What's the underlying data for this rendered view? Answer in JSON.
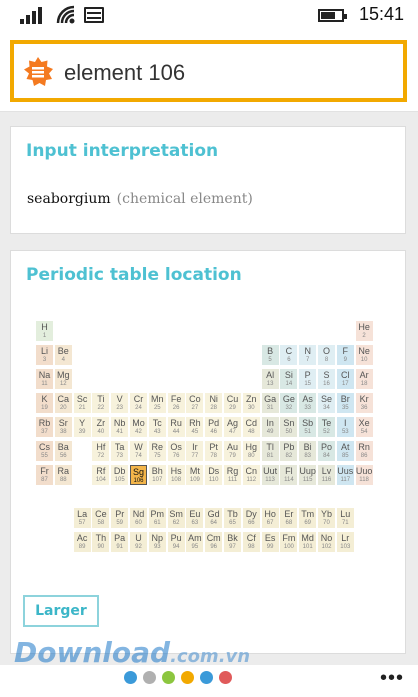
{
  "status_bar": {
    "time": "15:41"
  },
  "search": {
    "query": "element 106"
  },
  "pods": {
    "input_interpretation": {
      "title": "Input interpretation",
      "value": "seaborgium",
      "qualifier": "(chemical element)"
    },
    "periodic_table": {
      "title": "Periodic table location",
      "larger_label": "Larger",
      "selected_symbol": "Sg"
    }
  },
  "category_colors": {
    "h": "#e3eedd",
    "alkali": "#f2ddcb",
    "alkaline": "#f4e7d2",
    "transition": "#f7f2dc",
    "post": "#e6e8d9",
    "metalloid": "#d8e8e4",
    "nonmetal": "#dfeef3",
    "halogen": "#cfe6f1",
    "noble": "#f6e2d8",
    "lanth": "#f4eed5",
    "act": "#f4eed5"
  },
  "elements": [
    {
      "s": "H",
      "n": "1",
      "c": "h"
    },
    {
      "s": "He",
      "n": "2",
      "c": "noble"
    },
    {
      "s": "Li",
      "n": "3",
      "c": "alkali"
    },
    {
      "s": "Be",
      "n": "4",
      "c": "alkaline"
    },
    {
      "s": "B",
      "n": "5",
      "c": "metalloid"
    },
    {
      "s": "C",
      "n": "6",
      "c": "nonmetal"
    },
    {
      "s": "N",
      "n": "7",
      "c": "nonmetal"
    },
    {
      "s": "O",
      "n": "8",
      "c": "nonmetal"
    },
    {
      "s": "F",
      "n": "9",
      "c": "halogen"
    },
    {
      "s": "Ne",
      "n": "10",
      "c": "noble"
    },
    {
      "s": "Na",
      "n": "11",
      "c": "alkali"
    },
    {
      "s": "Mg",
      "n": "12",
      "c": "alkaline"
    },
    {
      "s": "Al",
      "n": "13",
      "c": "post"
    },
    {
      "s": "Si",
      "n": "14",
      "c": "metalloid"
    },
    {
      "s": "P",
      "n": "15",
      "c": "nonmetal"
    },
    {
      "s": "S",
      "n": "16",
      "c": "nonmetal"
    },
    {
      "s": "Cl",
      "n": "17",
      "c": "halogen"
    },
    {
      "s": "Ar",
      "n": "18",
      "c": "noble"
    },
    {
      "s": "K",
      "n": "19",
      "c": "alkali"
    },
    {
      "s": "Ca",
      "n": "20",
      "c": "alkaline"
    },
    {
      "s": "Sc",
      "n": "21",
      "c": "transition"
    },
    {
      "s": "Ti",
      "n": "22",
      "c": "transition"
    },
    {
      "s": "V",
      "n": "23",
      "c": "transition"
    },
    {
      "s": "Cr",
      "n": "24",
      "c": "transition"
    },
    {
      "s": "Mn",
      "n": "25",
      "c": "transition"
    },
    {
      "s": "Fe",
      "n": "26",
      "c": "transition"
    },
    {
      "s": "Co",
      "n": "27",
      "c": "transition"
    },
    {
      "s": "Ni",
      "n": "28",
      "c": "transition"
    },
    {
      "s": "Cu",
      "n": "29",
      "c": "transition"
    },
    {
      "s": "Zn",
      "n": "30",
      "c": "transition"
    },
    {
      "s": "Ga",
      "n": "31",
      "c": "post"
    },
    {
      "s": "Ge",
      "n": "32",
      "c": "metalloid"
    },
    {
      "s": "As",
      "n": "33",
      "c": "metalloid"
    },
    {
      "s": "Se",
      "n": "34",
      "c": "nonmetal"
    },
    {
      "s": "Br",
      "n": "35",
      "c": "halogen"
    },
    {
      "s": "Kr",
      "n": "36",
      "c": "noble"
    },
    {
      "s": "Rb",
      "n": "37",
      "c": "alkali"
    },
    {
      "s": "Sr",
      "n": "38",
      "c": "alkaline"
    },
    {
      "s": "Y",
      "n": "39",
      "c": "transition"
    },
    {
      "s": "Zr",
      "n": "40",
      "c": "transition"
    },
    {
      "s": "Nb",
      "n": "41",
      "c": "transition"
    },
    {
      "s": "Mo",
      "n": "42",
      "c": "transition"
    },
    {
      "s": "Tc",
      "n": "43",
      "c": "transition"
    },
    {
      "s": "Ru",
      "n": "44",
      "c": "transition"
    },
    {
      "s": "Rh",
      "n": "45",
      "c": "transition"
    },
    {
      "s": "Pd",
      "n": "46",
      "c": "transition"
    },
    {
      "s": "Ag",
      "n": "47",
      "c": "transition"
    },
    {
      "s": "Cd",
      "n": "48",
      "c": "transition"
    },
    {
      "s": "In",
      "n": "49",
      "c": "post"
    },
    {
      "s": "Sn",
      "n": "50",
      "c": "post"
    },
    {
      "s": "Sb",
      "n": "51",
      "c": "metalloid"
    },
    {
      "s": "Te",
      "n": "52",
      "c": "metalloid"
    },
    {
      "s": "I",
      "n": "53",
      "c": "halogen"
    },
    {
      "s": "Xe",
      "n": "54",
      "c": "noble"
    },
    {
      "s": "Cs",
      "n": "55",
      "c": "alkali"
    },
    {
      "s": "Ba",
      "n": "56",
      "c": "alkaline"
    },
    {
      "s": "Hf",
      "n": "72",
      "c": "transition"
    },
    {
      "s": "Ta",
      "n": "73",
      "c": "transition"
    },
    {
      "s": "W",
      "n": "74",
      "c": "transition"
    },
    {
      "s": "Re",
      "n": "75",
      "c": "transition"
    },
    {
      "s": "Os",
      "n": "76",
      "c": "transition"
    },
    {
      "s": "Ir",
      "n": "77",
      "c": "transition"
    },
    {
      "s": "Pt",
      "n": "78",
      "c": "transition"
    },
    {
      "s": "Au",
      "n": "79",
      "c": "transition"
    },
    {
      "s": "Hg",
      "n": "80",
      "c": "transition"
    },
    {
      "s": "Tl",
      "n": "81",
      "c": "post"
    },
    {
      "s": "Pb",
      "n": "82",
      "c": "post"
    },
    {
      "s": "Bi",
      "n": "83",
      "c": "post"
    },
    {
      "s": "Po",
      "n": "84",
      "c": "metalloid"
    },
    {
      "s": "At",
      "n": "85",
      "c": "halogen"
    },
    {
      "s": "Rn",
      "n": "86",
      "c": "noble"
    },
    {
      "s": "Fr",
      "n": "87",
      "c": "alkali"
    },
    {
      "s": "Ra",
      "n": "88",
      "c": "alkaline"
    },
    {
      "s": "Rf",
      "n": "104",
      "c": "transition"
    },
    {
      "s": "Db",
      "n": "105",
      "c": "transition"
    },
    {
      "s": "Sg",
      "n": "106",
      "c": "transition"
    },
    {
      "s": "Bh",
      "n": "107",
      "c": "transition"
    },
    {
      "s": "Hs",
      "n": "108",
      "c": "transition"
    },
    {
      "s": "Mt",
      "n": "109",
      "c": "transition"
    },
    {
      "s": "Ds",
      "n": "110",
      "c": "transition"
    },
    {
      "s": "Rg",
      "n": "111",
      "c": "transition"
    },
    {
      "s": "Cn",
      "n": "112",
      "c": "transition"
    },
    {
      "s": "Uut",
      "n": "113",
      "c": "post"
    },
    {
      "s": "Fl",
      "n": "114",
      "c": "post"
    },
    {
      "s": "Uup",
      "n": "115",
      "c": "post"
    },
    {
      "s": "Lv",
      "n": "116",
      "c": "post"
    },
    {
      "s": "Uus",
      "n": "117",
      "c": "halogen"
    },
    {
      "s": "Uuo",
      "n": "118",
      "c": "noble"
    },
    {
      "s": "La",
      "n": "57",
      "c": "lanth"
    },
    {
      "s": "Ce",
      "n": "58",
      "c": "lanth"
    },
    {
      "s": "Pr",
      "n": "59",
      "c": "lanth"
    },
    {
      "s": "Nd",
      "n": "60",
      "c": "lanth"
    },
    {
      "s": "Pm",
      "n": "61",
      "c": "lanth"
    },
    {
      "s": "Sm",
      "n": "62",
      "c": "lanth"
    },
    {
      "s": "Eu",
      "n": "63",
      "c": "lanth"
    },
    {
      "s": "Gd",
      "n": "64",
      "c": "lanth"
    },
    {
      "s": "Tb",
      "n": "65",
      "c": "lanth"
    },
    {
      "s": "Dy",
      "n": "66",
      "c": "lanth"
    },
    {
      "s": "Ho",
      "n": "67",
      "c": "lanth"
    },
    {
      "s": "Er",
      "n": "68",
      "c": "lanth"
    },
    {
      "s": "Tm",
      "n": "69",
      "c": "lanth"
    },
    {
      "s": "Yb",
      "n": "70",
      "c": "lanth"
    },
    {
      "s": "Lu",
      "n": "71",
      "c": "lanth"
    },
    {
      "s": "Ac",
      "n": "89",
      "c": "act"
    },
    {
      "s": "Th",
      "n": "90",
      "c": "act"
    },
    {
      "s": "Pa",
      "n": "91",
      "c": "act"
    },
    {
      "s": "U",
      "n": "92",
      "c": "act"
    },
    {
      "s": "Np",
      "n": "93",
      "c": "act"
    },
    {
      "s": "Pu",
      "n": "94",
      "c": "act"
    },
    {
      "s": "Am",
      "n": "95",
      "c": "act"
    },
    {
      "s": "Cm",
      "n": "96",
      "c": "act"
    },
    {
      "s": "Bk",
      "n": "97",
      "c": "act"
    },
    {
      "s": "Cf",
      "n": "98",
      "c": "act"
    },
    {
      "s": "Es",
      "n": "99",
      "c": "act"
    },
    {
      "s": "Fm",
      "n": "100",
      "c": "act"
    },
    {
      "s": "Md",
      "n": "101",
      "c": "act"
    },
    {
      "s": "No",
      "n": "102",
      "c": "act"
    },
    {
      "s": "Lr",
      "n": "103",
      "c": "act"
    }
  ],
  "page_dots": [
    "#3b9ad9",
    "#b0b0b0",
    "#8cc63f",
    "#f2a900",
    "#3b9ad9",
    "#e05a5a"
  ],
  "watermark": {
    "main": "Download",
    "domain": ".com.vn"
  },
  "more_label": "•••"
}
